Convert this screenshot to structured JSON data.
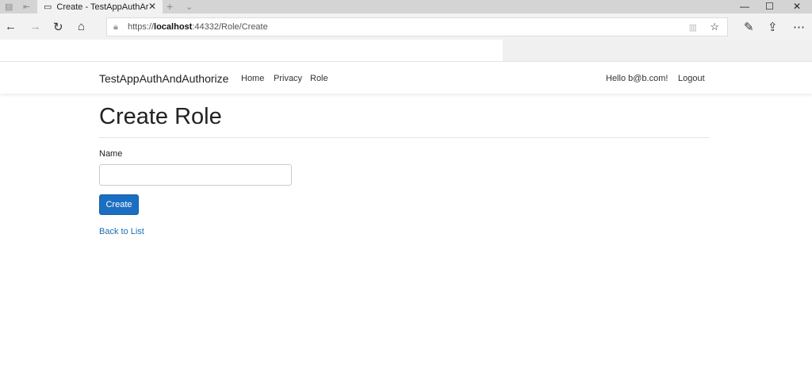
{
  "browser": {
    "tab_title": "Create - TestAppAuthAr",
    "url_prefix": "https://",
    "url_host": "localhost",
    "url_rest": ":44332/Role/Create"
  },
  "nav": {
    "brand": "TestAppAuthAndAuthorize",
    "links": [
      "Home",
      "Privacy",
      "Role"
    ],
    "greeting": "Hello b@b.com!",
    "logout": "Logout"
  },
  "page": {
    "title": "Create Role",
    "name_label": "Name",
    "name_value": "",
    "create_button": "Create",
    "back_link": "Back to List"
  }
}
